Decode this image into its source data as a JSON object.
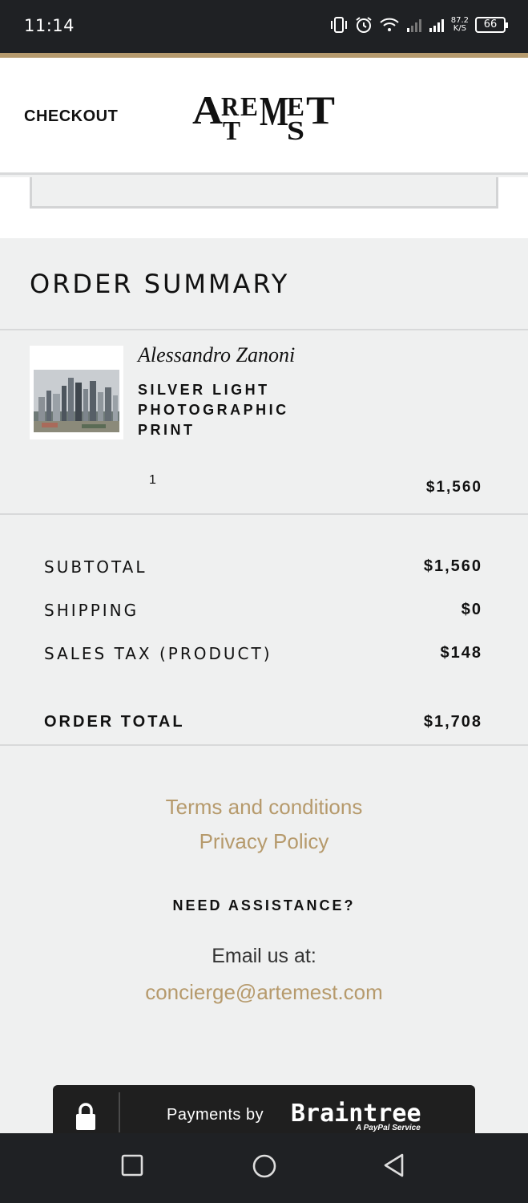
{
  "status_bar": {
    "time": "11:14",
    "network_speed_value": "87.2",
    "network_speed_unit": "K/S",
    "battery": "66"
  },
  "header": {
    "checkout_label": "CHECKOUT",
    "logo_text": "ARTEMEST"
  },
  "order_summary": {
    "title": "ORDER SUMMARY",
    "item": {
      "artist": "Alessandro Zanoni",
      "product_name": "SILVER LIGHT PHOTOGRAPHIC PRINT",
      "quantity": "1",
      "price": "$1,560"
    },
    "rows": [
      {
        "label": "SUBTOTAL",
        "value": "$1,560"
      },
      {
        "label": "SHIPPING",
        "value": "$0"
      },
      {
        "label": "SALES TAX (PRODUCT)",
        "value": "$148"
      }
    ],
    "total": {
      "label": "ORDER TOTAL",
      "value": "$1,708"
    }
  },
  "footer": {
    "terms_link": "Terms and conditions",
    "privacy_link": "Privacy Policy",
    "assistance_heading": "NEED ASSISTANCE?",
    "email_label": "Email us at:",
    "email_link": "concierge@artemest.com"
  },
  "payment_badge": {
    "prefix": "Payments by",
    "brand": "Braintree",
    "subtext": "A PayPal Service"
  },
  "colors": {
    "accent_gold": "#b69a6c",
    "dark_bar": "#1f2124",
    "page_bg": "#eff0f0"
  }
}
